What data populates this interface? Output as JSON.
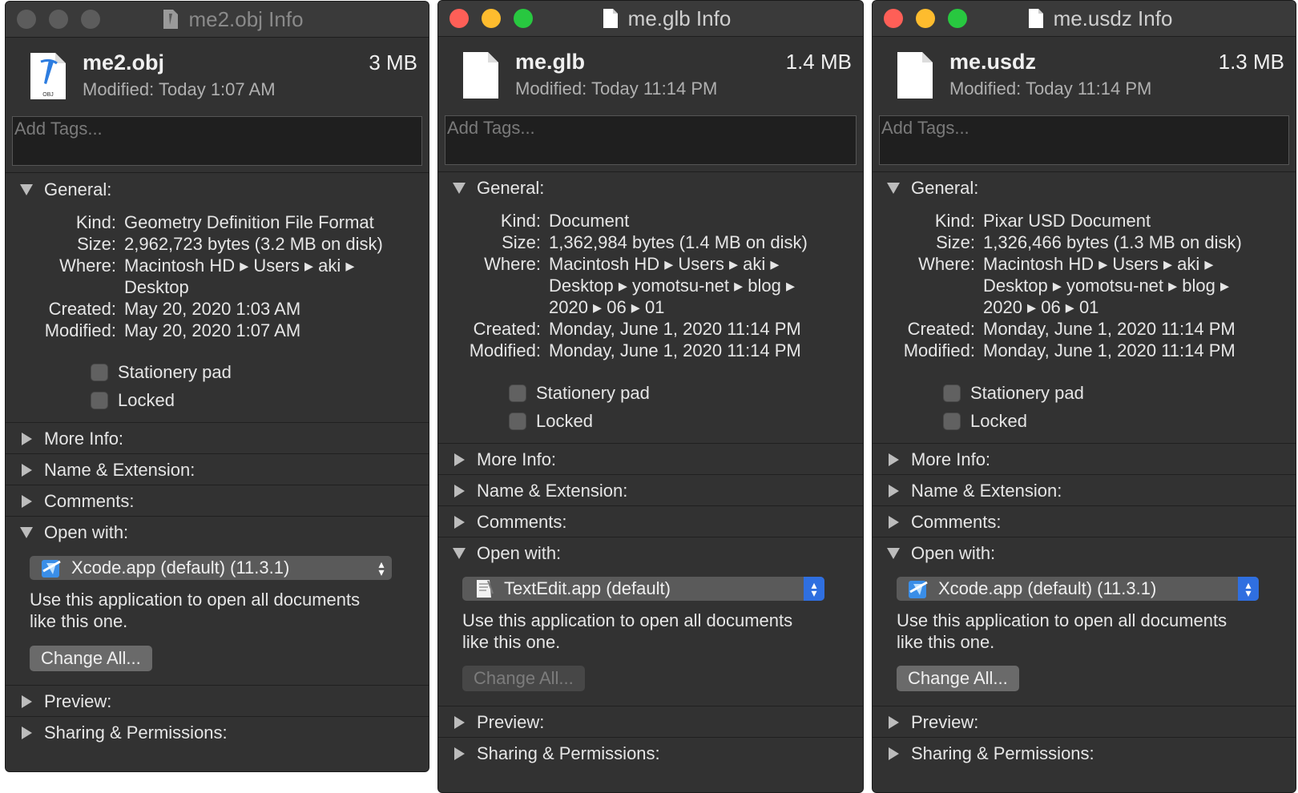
{
  "windows": [
    {
      "title": "me2.obj Info",
      "file_name": "me2.obj",
      "file_size": "3 MB",
      "modified_label": "Modified:",
      "modified_value": "Today 1:07 AM",
      "file_icon": "obj-file-icon",
      "file_icon_label": "OBJ",
      "tags_placeholder": "Add Tags...",
      "general_label": "General:",
      "kind_label": "Kind:",
      "kind": "Geometry Definition File Format",
      "size_label": "Size:",
      "size": "2,962,723 bytes (3.2 MB on disk)",
      "where_label": "Where:",
      "where_lines": [
        "Macintosh HD ▸ Users ▸ aki ▸",
        "Desktop"
      ],
      "created_label": "Created:",
      "created": "May 20, 2020 1:03 AM",
      "modified_full_label": "Modified:",
      "modified_full": "May 20, 2020 1:07 AM",
      "stationery_label": "Stationery pad",
      "locked_label": "Locked",
      "more_info_label": "More Info:",
      "name_ext_label": "Name & Extension:",
      "comments_label": "Comments:",
      "open_with_label": "Open with:",
      "open_with_app": "Xcode.app (default) (11.3.1)",
      "open_with_icon": "xcode-app-icon",
      "desc_lines": [
        "Use this application to open all documents",
        "like this one."
      ],
      "change_all_label": "Change All...",
      "preview_label": "Preview:",
      "sharing_label": "Sharing & Permissions:"
    },
    {
      "title": "me.glb Info",
      "file_name": "me.glb",
      "file_size": "1.4 MB",
      "modified_label": "Modified:",
      "modified_value": "Today 11:14 PM",
      "file_icon": "document-icon",
      "tags_placeholder": "Add Tags...",
      "general_label": "General:",
      "kind_label": "Kind:",
      "kind": "Document",
      "size_label": "Size:",
      "size": "1,362,984 bytes (1.4 MB on disk)",
      "where_label": "Where:",
      "where_lines": [
        "Macintosh HD ▸ Users ▸ aki ▸",
        "Desktop ▸ yomotsu-net ▸ blog ▸",
        "2020 ▸ 06 ▸ 01"
      ],
      "created_label": "Created:",
      "created": "Monday, June 1, 2020 11:14 PM",
      "modified_full_label": "Modified:",
      "modified_full": "Monday, June 1, 2020 11:14 PM",
      "stationery_label": "Stationery pad",
      "locked_label": "Locked",
      "more_info_label": "More Info:",
      "name_ext_label": "Name & Extension:",
      "comments_label": "Comments:",
      "open_with_label": "Open with:",
      "open_with_app": "TextEdit.app (default)",
      "open_with_icon": "textedit-app-icon",
      "desc_lines": [
        "Use this application to open all documents",
        "like this one."
      ],
      "change_all_label": "Change All...",
      "preview_label": "Preview:",
      "sharing_label": "Sharing & Permissions:"
    },
    {
      "title": "me.usdz Info",
      "file_name": "me.usdz",
      "file_size": "1.3 MB",
      "modified_label": "Modified:",
      "modified_value": "Today 11:14 PM",
      "file_icon": "document-icon",
      "tags_placeholder": "Add Tags...",
      "general_label": "General:",
      "kind_label": "Kind:",
      "kind": "Pixar USD Document",
      "size_label": "Size:",
      "size": "1,326,466 bytes (1.3 MB on disk)",
      "where_label": "Where:",
      "where_lines": [
        "Macintosh HD ▸ Users ▸ aki ▸",
        "Desktop ▸ yomotsu-net ▸ blog ▸",
        "2020 ▸ 06 ▸ 01"
      ],
      "created_label": "Created:",
      "created": "Monday, June 1, 2020 11:14 PM",
      "modified_full_label": "Modified:",
      "modified_full": "Monday, June 1, 2020 11:14 PM",
      "stationery_label": "Stationery pad",
      "locked_label": "Locked",
      "more_info_label": "More Info:",
      "name_ext_label": "Name & Extension:",
      "comments_label": "Comments:",
      "open_with_label": "Open with:",
      "open_with_app": "Xcode.app (default) (11.3.1)",
      "open_with_icon": "xcode-app-icon",
      "desc_lines": [
        "Use this application to open all documents",
        "like this one."
      ],
      "change_all_label": "Change All...",
      "preview_label": "Preview:",
      "sharing_label": "Sharing & Permissions:"
    }
  ],
  "colors": {
    "window_bg": "#323232",
    "close": "#fe5f57",
    "minimize": "#febc2e",
    "zoom": "#28c840",
    "popup_accent": "#2f6fe0"
  }
}
